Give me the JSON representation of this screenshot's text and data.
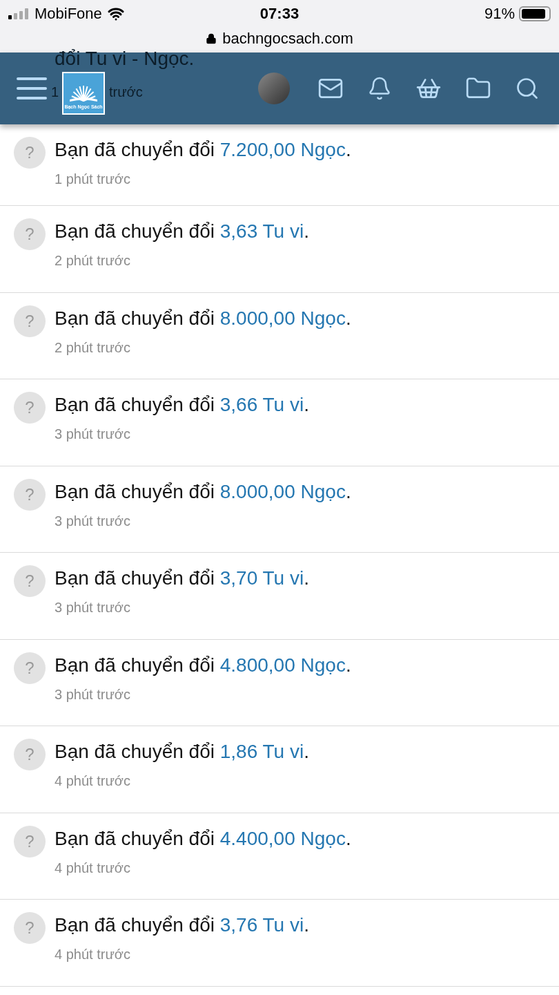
{
  "status_bar": {
    "carrier": "MobiFone",
    "time": "07:33",
    "battery": "91%"
  },
  "address_bar": {
    "url": "bachngocsach.com"
  },
  "header": {
    "logo_text": "Bạch Ngọc Sách",
    "peek_title": "đổi Tu vi - Ngọc.",
    "peek_time_start": "1",
    "peek_time_end": "trước"
  },
  "notifications": [
    {
      "icon": "?",
      "text": "Bạn đã chuyển đổi ",
      "amount": "7.200,00 Ngọc",
      "end": ".",
      "time": "1 phút trước"
    },
    {
      "icon": "?",
      "text": "Bạn đã chuyển đổi ",
      "amount": "3,63 Tu vi",
      "end": ".",
      "time": "2 phút trước"
    },
    {
      "icon": "?",
      "text": "Bạn đã chuyển đổi ",
      "amount": "8.000,00 Ngọc",
      "end": ".",
      "time": "2 phút trước"
    },
    {
      "icon": "?",
      "text": "Bạn đã chuyển đổi ",
      "amount": "3,66 Tu vi",
      "end": ".",
      "time": "3 phút trước"
    },
    {
      "icon": "?",
      "text": "Bạn đã chuyển đổi ",
      "amount": "8.000,00 Ngọc",
      "end": ".",
      "time": "3 phút trước"
    },
    {
      "icon": "?",
      "text": "Bạn đã chuyển đổi ",
      "amount": "3,70 Tu vi",
      "end": ".",
      "time": "3 phút trước"
    },
    {
      "icon": "?",
      "text": "Bạn đã chuyển đổi ",
      "amount": "4.800,00 Ngọc",
      "end": ".",
      "time": "3 phút trước"
    },
    {
      "icon": "?",
      "text": "Bạn đã chuyển đổi ",
      "amount": "1,86 Tu vi",
      "end": ".",
      "time": "4 phút trước"
    },
    {
      "icon": "?",
      "text": "Bạn đã chuyển đổi ",
      "amount": "4.400,00 Ngọc",
      "end": ".",
      "time": "4 phút trước"
    },
    {
      "icon": "?",
      "text": "Bạn đã chuyển đổi ",
      "amount": "3,76 Tu vi",
      "end": ".",
      "time": "4 phút trước"
    }
  ]
}
